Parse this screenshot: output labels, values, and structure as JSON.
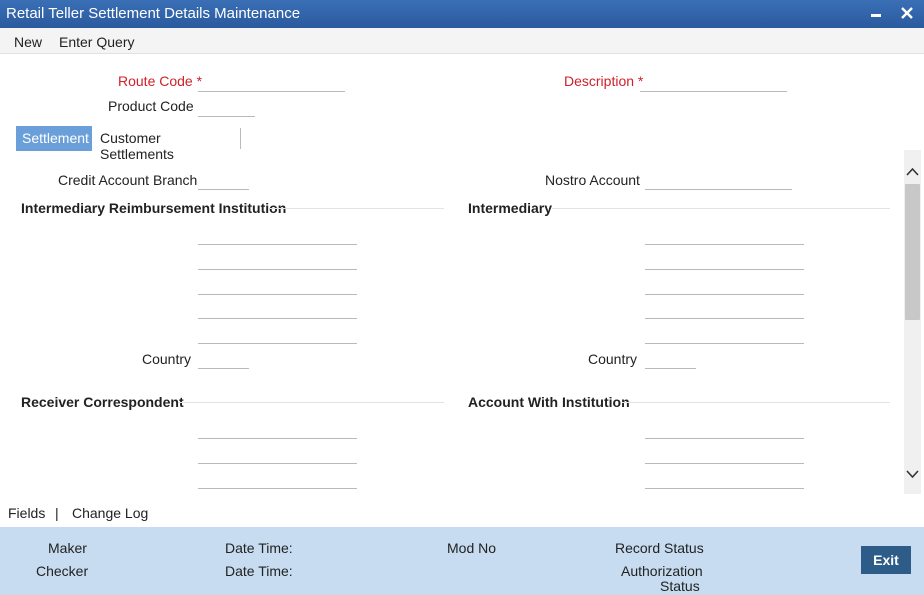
{
  "window": {
    "title": "Retail Teller Settlement Details Maintenance"
  },
  "menu": {
    "new": "New",
    "enter_query": "Enter Query"
  },
  "header": {
    "route_code_label": "Route Code *",
    "description_label": "Description *",
    "product_code_label": "Product Code"
  },
  "tabs": {
    "settlement": "Settlement",
    "customer_settlements": "Customer Settlements"
  },
  "settlement": {
    "credit_account_branch": "Credit Account Branch",
    "nostro_account": "Nostro Account",
    "intermediary_reimbursement_institution": "Intermediary Reimbursement Institution",
    "intermediary": "Intermediary",
    "country_left": "Country",
    "country_right": "Country",
    "receiver_correspondent": "Receiver Correspondent",
    "account_with_institution": "Account With Institution"
  },
  "footer": {
    "fields": "Fields",
    "separator": "|",
    "change_log": "Change Log"
  },
  "status": {
    "maker": "Maker",
    "checker": "Checker",
    "date_time_1": "Date Time:",
    "date_time_2": "Date Time:",
    "mod_no": "Mod No",
    "record_status": "Record Status",
    "authorization_status_1": "Authorization",
    "authorization_status_2": "Status",
    "exit": "Exit"
  },
  "colors": {
    "title_bar": "#2a5a9e",
    "tab_active": "#6b9fd9",
    "status_bar": "#c7dcf0",
    "exit_button": "#2c5c87",
    "required_label": "#d0202a"
  }
}
